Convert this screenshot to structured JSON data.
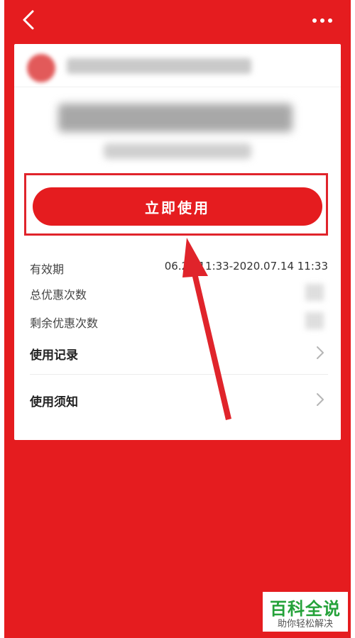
{
  "colors": {
    "primary_red": "#e51c1f",
    "highlight_border": "#e0242b",
    "watermark_green": "#25a23a"
  },
  "header": {
    "back_icon": "chevron-left-icon",
    "more_icon": "more-dots-icon"
  },
  "coupon": {
    "use_now_label": "立即使用"
  },
  "details": {
    "validity_label": "有效期",
    "validity_value": "06.24 11:33-2020.07.14 11:33",
    "total_uses_label": "总优惠次数",
    "remaining_uses_label": "剩余优惠次数"
  },
  "links": {
    "usage_record": "使用记录",
    "usage_notice": "使用须知"
  },
  "watermark": {
    "title": "百科全说",
    "subtitle": "助你轻松解决"
  }
}
